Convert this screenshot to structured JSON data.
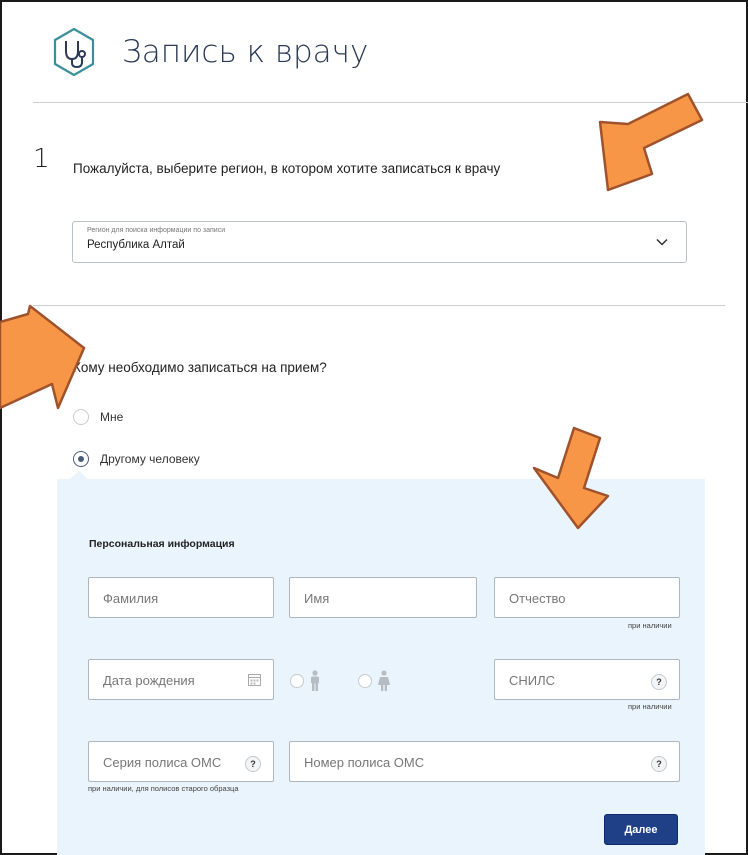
{
  "header": {
    "title": "Запись к врачу",
    "logo_icon": "stethoscope-icon"
  },
  "step1": {
    "number": "1",
    "question": "Пожалуйста, выберите регион, в котором хотите записаться к врачу",
    "region_select": {
      "label": "Регион для поиска информации по записи",
      "value": "Республика Алтай",
      "icon": "chevron-down-icon"
    }
  },
  "who": {
    "question": "Кому необходимо записаться на прием?",
    "options": [
      {
        "label": "Мне",
        "selected": false
      },
      {
        "label": "Другому человеку",
        "selected": true
      }
    ]
  },
  "personal": {
    "title": "Персональная информация",
    "last_name": {
      "placeholder": "Фамилия"
    },
    "first_name": {
      "placeholder": "Имя"
    },
    "patronymic": {
      "placeholder": "Отчество",
      "hint": "при наличии"
    },
    "birth_date": {
      "placeholder": "Дата рождения",
      "icon": "calendar-icon"
    },
    "gender": {
      "male_icon": "male-icon",
      "female_icon": "female-icon"
    },
    "snils": {
      "placeholder": "СНИЛС",
      "hint": "при наличии",
      "help": "?"
    },
    "policy_series": {
      "placeholder": "Серия полиса ОМС",
      "hint": "при наличии, для полисов старого образца",
      "help": "?"
    },
    "policy_number": {
      "placeholder": "Номер полиса ОМС",
      "help": "?"
    },
    "next_button": "Далее"
  },
  "annotations": {
    "arrow_color": "#f79646",
    "arrow_outline": "#a0522d"
  }
}
